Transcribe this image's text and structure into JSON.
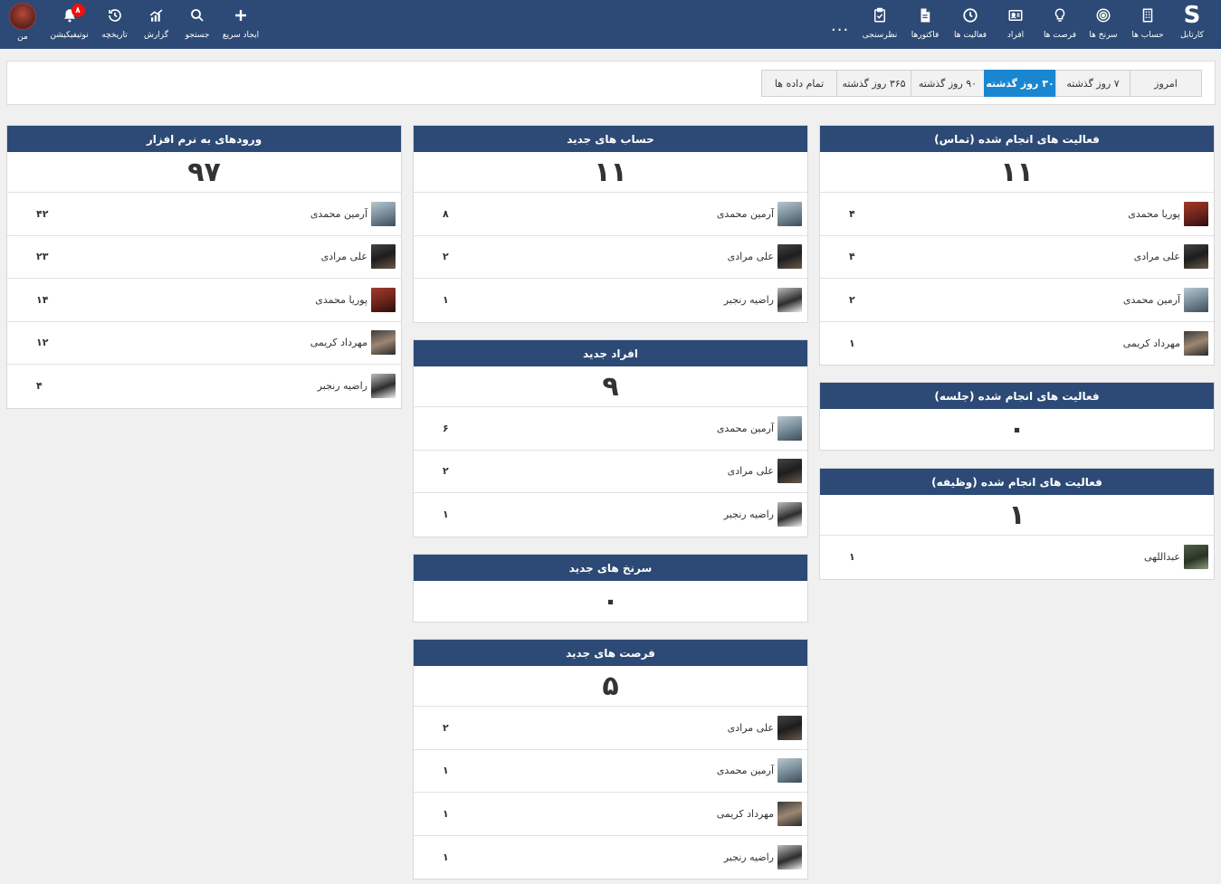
{
  "nav_right": [
    {
      "id": "cartable",
      "label": "کارتابل",
      "icon": "logo-s-icon"
    },
    {
      "id": "accounts",
      "label": "حساب ها",
      "icon": "building-icon"
    },
    {
      "id": "leads",
      "label": "سرنخ ها",
      "icon": "target-icon"
    },
    {
      "id": "opportunities",
      "label": "فرصت ها",
      "icon": "lightbulb-icon"
    },
    {
      "id": "people",
      "label": "افراد",
      "icon": "contact-card-icon"
    },
    {
      "id": "activities",
      "label": "فعالیت ها",
      "icon": "clock-icon"
    },
    {
      "id": "invoices",
      "label": "فاکتورها",
      "icon": "document-icon"
    },
    {
      "id": "survey",
      "label": "نظرسنجی",
      "icon": "clipboard-check-icon"
    }
  ],
  "nav_more": "...",
  "nav_left": [
    {
      "id": "quick-create",
      "label": "ایجاد سریع",
      "icon": "plus-icon"
    },
    {
      "id": "search",
      "label": "جستجو",
      "icon": "search-icon"
    },
    {
      "id": "report",
      "label": "گزارش",
      "icon": "chart-icon"
    },
    {
      "id": "history",
      "label": "تاریخچه",
      "icon": "history-icon"
    },
    {
      "id": "notifications",
      "label": "نوتیفیکیشن",
      "icon": "bell-icon",
      "badge": "۸"
    },
    {
      "id": "me",
      "label": "من",
      "icon": "avatar"
    }
  ],
  "filters": {
    "items": [
      "امروز",
      "۷ روز گذشته",
      "۳۰ روز گذشته",
      "۹۰ روز گذشته",
      "۳۶۵ روز گذشته",
      "تمام داده ها"
    ],
    "active": "۳۰ روز گذشته"
  },
  "cards": {
    "contacts_done": {
      "title": "فعالیت های انجام شده (تماس)",
      "total": "۱۱",
      "rows": [
        {
          "name": "پوریا محمدی",
          "value": "۴",
          "pic": "pouria"
        },
        {
          "name": "علی مرادی",
          "value": "۴",
          "pic": "ali"
        },
        {
          "name": "آرمین محمدی",
          "value": "۲",
          "pic": "armin"
        },
        {
          "name": "مهرداد کریمی",
          "value": "۱",
          "pic": "mehrdad"
        }
      ]
    },
    "meetings_done": {
      "title": "فعالیت های انجام شده (جلسه)",
      "total": "۰",
      "rows": []
    },
    "tasks_done": {
      "title": "فعالیت های انجام شده (وظیفه)",
      "total": "۱",
      "rows": [
        {
          "name": "عبداللهی",
          "value": "۱",
          "pic": "abdollahi"
        }
      ]
    },
    "new_accounts": {
      "title": "حساب های جدید",
      "total": "۱۱",
      "rows": [
        {
          "name": "آرمین محمدی",
          "value": "۸",
          "pic": "armin"
        },
        {
          "name": "علی مرادی",
          "value": "۲",
          "pic": "ali"
        },
        {
          "name": "راضیه رنجبر",
          "value": "۱",
          "pic": "razieh"
        }
      ]
    },
    "new_people": {
      "title": "افراد جدید",
      "total": "۹",
      "rows": [
        {
          "name": "آرمین محمدی",
          "value": "۶",
          "pic": "armin"
        },
        {
          "name": "علی مرادی",
          "value": "۲",
          "pic": "ali"
        },
        {
          "name": "راضیه رنجبر",
          "value": "۱",
          "pic": "razieh"
        }
      ]
    },
    "new_leads": {
      "title": "سرنخ های جدید",
      "total": "۰",
      "rows": []
    },
    "new_opportunities": {
      "title": "فرصت های جدید",
      "total": "۵",
      "rows": [
        {
          "name": "علی مرادی",
          "value": "۲",
          "pic": "ali"
        },
        {
          "name": "آرمین محمدی",
          "value": "۱",
          "pic": "armin"
        },
        {
          "name": "مهرداد کریمی",
          "value": "۱",
          "pic": "mehrdad"
        },
        {
          "name": "راضیه رنجبر",
          "value": "۱",
          "pic": "razieh"
        }
      ]
    },
    "logins": {
      "title": "ورودهای به نرم افزار",
      "total": "۹۷",
      "rows": [
        {
          "name": "آرمین محمدی",
          "value": "۴۲",
          "pic": "armin"
        },
        {
          "name": "علی مرادی",
          "value": "۲۳",
          "pic": "ali"
        },
        {
          "name": "پوریا محمدی",
          "value": "۱۴",
          "pic": "pouria"
        },
        {
          "name": "مهرداد کریمی",
          "value": "۱۲",
          "pic": "mehrdad"
        },
        {
          "name": "راضیه رنجبر",
          "value": "۴",
          "pic": "razieh"
        }
      ]
    }
  }
}
